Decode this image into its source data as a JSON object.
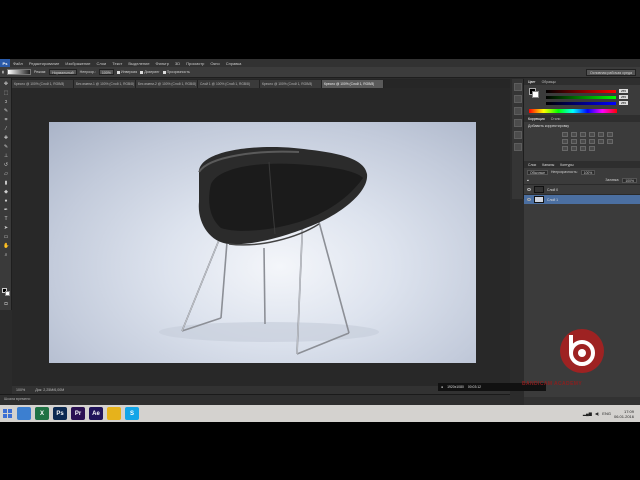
{
  "photoshop": {
    "logo": "Ps",
    "menu": [
      "Файл",
      "Редактирование",
      "Изображение",
      "Слои",
      "Текст",
      "Выделение",
      "Фильтр",
      "3D",
      "Просмотр",
      "Окно",
      "Справка"
    ],
    "options": {
      "mode_label": "Режим:",
      "mode_value": "Нормальный",
      "opacity_label": "Непрозр.:",
      "opacity_value": "100%",
      "checkboxes": [
        "Инверсия",
        "Дизеринг",
        "Прозрачность"
      ],
      "workspace": "Основная рабочая среда"
    },
    "tabs": [
      {
        "title": "Кресло @ 100% (Слой 1, RGB/8)",
        "active": false
      },
      {
        "title": "Без имени-1 @ 100% (Слой 1, RGB/8)",
        "active": false
      },
      {
        "title": "Без имени-2 @ 100% (Слой 1, RGB/8)",
        "active": false
      },
      {
        "title": "Слой 1 @ 100% (Слой 1, RGB/8)",
        "active": false
      },
      {
        "title": "Кресло @ 100% (Слой 1, RGB/8)",
        "active": false
      },
      {
        "title": "Кресло @ 100% (Слой 1, RGB/8)",
        "active": true
      }
    ],
    "status": {
      "zoom": "100%",
      "doc": "Док: 2,25M/6,00M"
    },
    "timeline_label": "Шкала времени",
    "panels": {
      "color_tabs": [
        "Цвет",
        "Образцы"
      ],
      "rgb_values": {
        "r": "255",
        "g": "255",
        "b": "255"
      },
      "adjustments_tabs": [
        "Коррекция",
        "Стили"
      ],
      "adjustments_title": "Добавить корректировку",
      "layers_tabs": [
        "Слои",
        "Каналы",
        "Контуры"
      ],
      "blend_mode": "Обычные",
      "opacity_label": "Непрозрачность:",
      "opacity_value": "100%",
      "fill_label": "Заливка:",
      "fill_value": "100%",
      "layers": [
        {
          "name": "Слой 0",
          "selected": false
        },
        {
          "name": "Слой 1",
          "selected": true
        }
      ]
    }
  },
  "recording": {
    "fps_text": "1920x1080",
    "timer": "00:03:12",
    "overlay_text": "BANDICAM ACADEMY"
  },
  "taskbar": {
    "apps": [
      {
        "icon": "explorer-icon",
        "label": "",
        "color": "#3c7fd0"
      },
      {
        "icon": "excel-icon",
        "label": "X",
        "color": "#1f7244"
      },
      {
        "icon": "photoshop-icon",
        "label": "Ps",
        "color": "#0c2a52"
      },
      {
        "icon": "premiere-icon",
        "label": "Pr",
        "color": "#2a1052"
      },
      {
        "icon": "aftereffects-icon",
        "label": "Ae",
        "color": "#20135a"
      },
      {
        "icon": "chrome-icon",
        "label": "",
        "color": "#e6b21b"
      },
      {
        "icon": "skype-icon",
        "label": "S",
        "color": "#12a5e8"
      }
    ],
    "tray": {
      "lang": "ENG",
      "time": "17:09",
      "date": "06.01.2016"
    }
  }
}
